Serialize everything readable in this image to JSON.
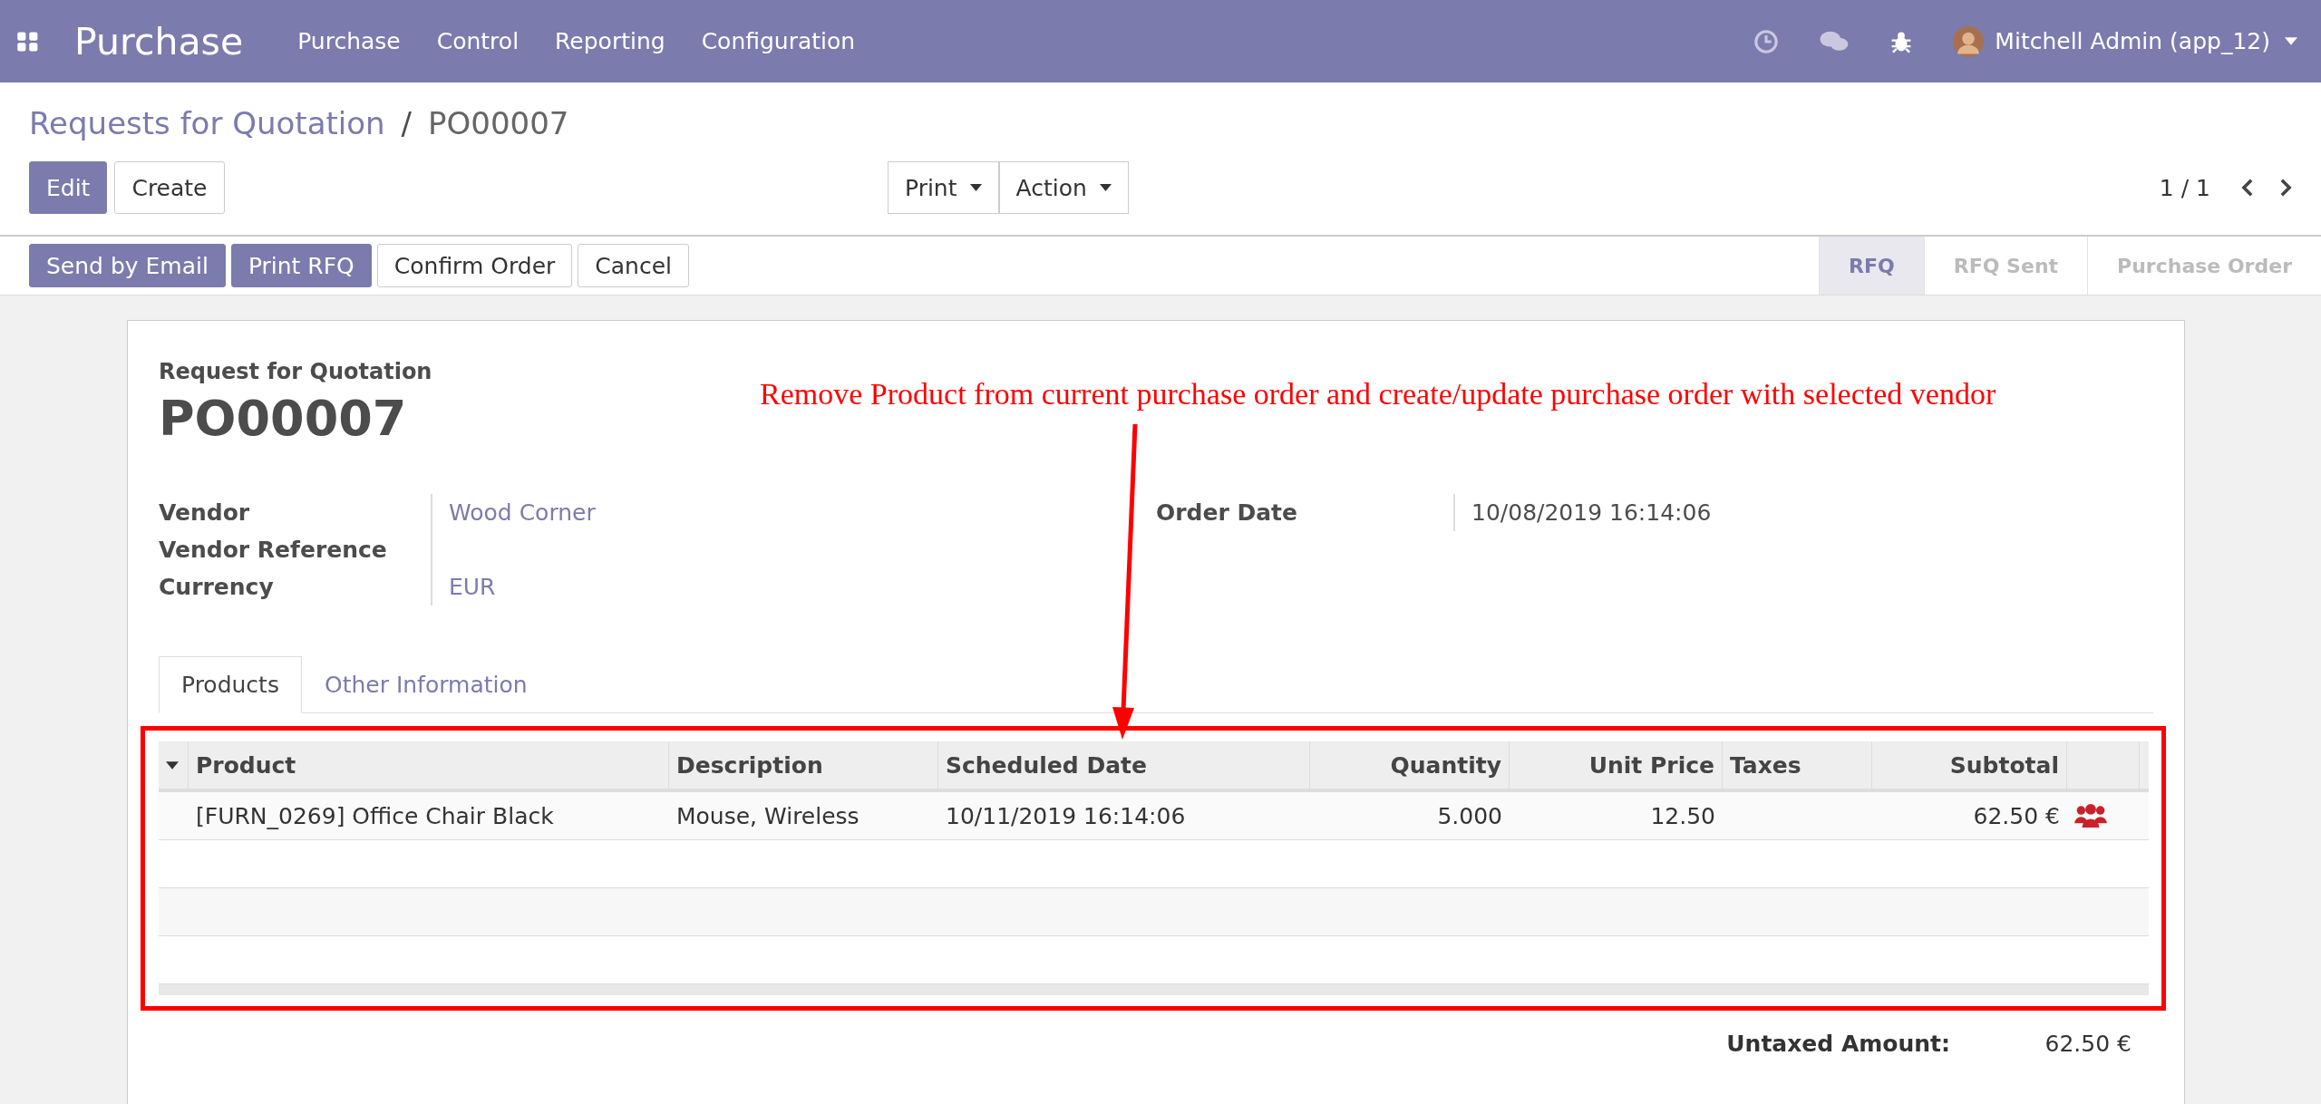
{
  "navbar": {
    "app_name": "Purchase",
    "menus": [
      "Purchase",
      "Control",
      "Reporting",
      "Configuration"
    ],
    "user": "Mitchell Admin (app_12)"
  },
  "breadcrumb": {
    "parent": "Requests for Quotation",
    "separator": "/",
    "current": "PO00007"
  },
  "buttons": [
    {
      "label": "Edit",
      "primary": true
    },
    {
      "label": "Create",
      "primary": false
    }
  ],
  "dropdowns": [
    "Print",
    "Action"
  ],
  "pager": {
    "value": "1 / 1"
  },
  "header_buttons": [
    {
      "label": "Send by Email",
      "primary": true
    },
    {
      "label": "Print RFQ",
      "primary": true
    },
    {
      "label": "Confirm Order",
      "primary": false
    },
    {
      "label": "Cancel",
      "primary": false
    }
  ],
  "statusbar": [
    {
      "label": "RFQ",
      "selected": true
    },
    {
      "label": "RFQ Sent",
      "selected": false
    },
    {
      "label": "Purchase Order",
      "selected": false
    }
  ],
  "sheet": {
    "subtitle": "Request for Quotation",
    "title": "PO00007",
    "left_fields": [
      {
        "label": "Vendor",
        "value": "Wood Corner"
      },
      {
        "label": "Vendor Reference"
      },
      {
        "label": "Currency",
        "value": "EUR"
      }
    ],
    "right_fields": [
      {
        "label": "Order Date",
        "value": "10/08/2019 16:14:06"
      }
    ],
    "tabs": [
      {
        "label": "Products",
        "selected": true
      },
      {
        "label": "Other Information",
        "selected": false
      }
    ],
    "table": {
      "columns": [
        {
          "label": "Product",
          "numeric": false
        },
        {
          "label": "Description",
          "numeric": false
        },
        {
          "label": "Scheduled Date",
          "numeric": false
        },
        {
          "label": "Quantity",
          "numeric": true
        },
        {
          "label": "Unit Price",
          "numeric": true
        },
        {
          "label": "Taxes",
          "numeric": false
        },
        {
          "label": "Subtotal",
          "numeric": true
        }
      ],
      "rows": [
        {
          "cells": [
            "[FURN_0269] Office Chair Black",
            "Mouse, Wireless",
            "10/11/2019 16:14:06",
            "5.000",
            "12.50",
            "",
            "62.50 €"
          ]
        }
      ]
    },
    "totals": [
      {
        "label": "Untaxed Amount:",
        "value": "62.50 €"
      }
    ]
  },
  "annotation": {
    "text": "Remove Product from current purchase order and create/update purchase order with selected vendor"
  }
}
